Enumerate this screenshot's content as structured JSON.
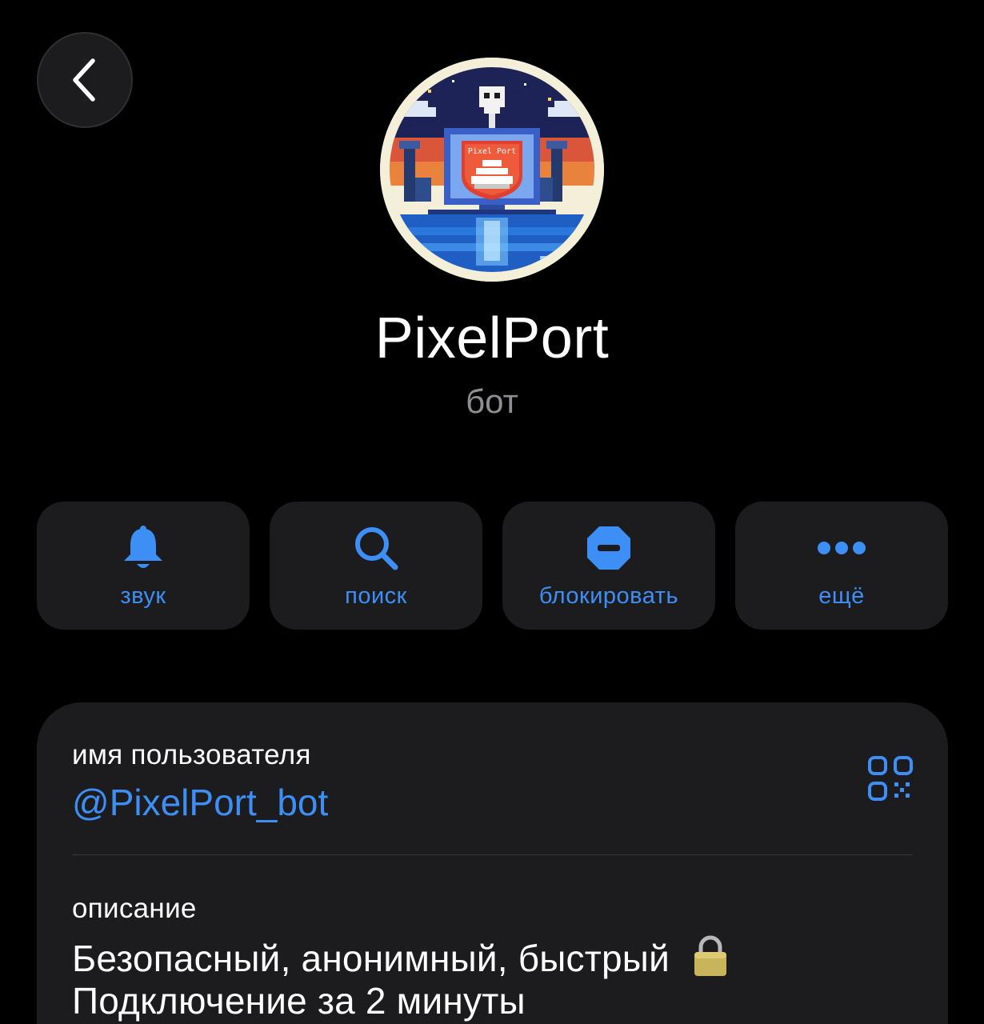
{
  "profile": {
    "name": "PixelPort",
    "type_label": "бот",
    "avatar_text": "Pixel Port"
  },
  "actions": [
    {
      "label": "звук",
      "icon": "bell-icon"
    },
    {
      "label": "поиск",
      "icon": "search-icon"
    },
    {
      "label": "блокировать",
      "icon": "block-icon"
    },
    {
      "label": "ещё",
      "icon": "more-icon"
    }
  ],
  "info": {
    "username_label": "имя пользователя",
    "username": "@PixelPort_bot",
    "description_label": "описание",
    "description_lines": [
      "Безопасный, анонимный, быстрый",
      "Подключение за 2 минуты"
    ]
  },
  "colors": {
    "accent": "#3e8ff5",
    "background": "#000000",
    "card": "#1c1c1e",
    "secondary_text": "#8e8e93"
  }
}
